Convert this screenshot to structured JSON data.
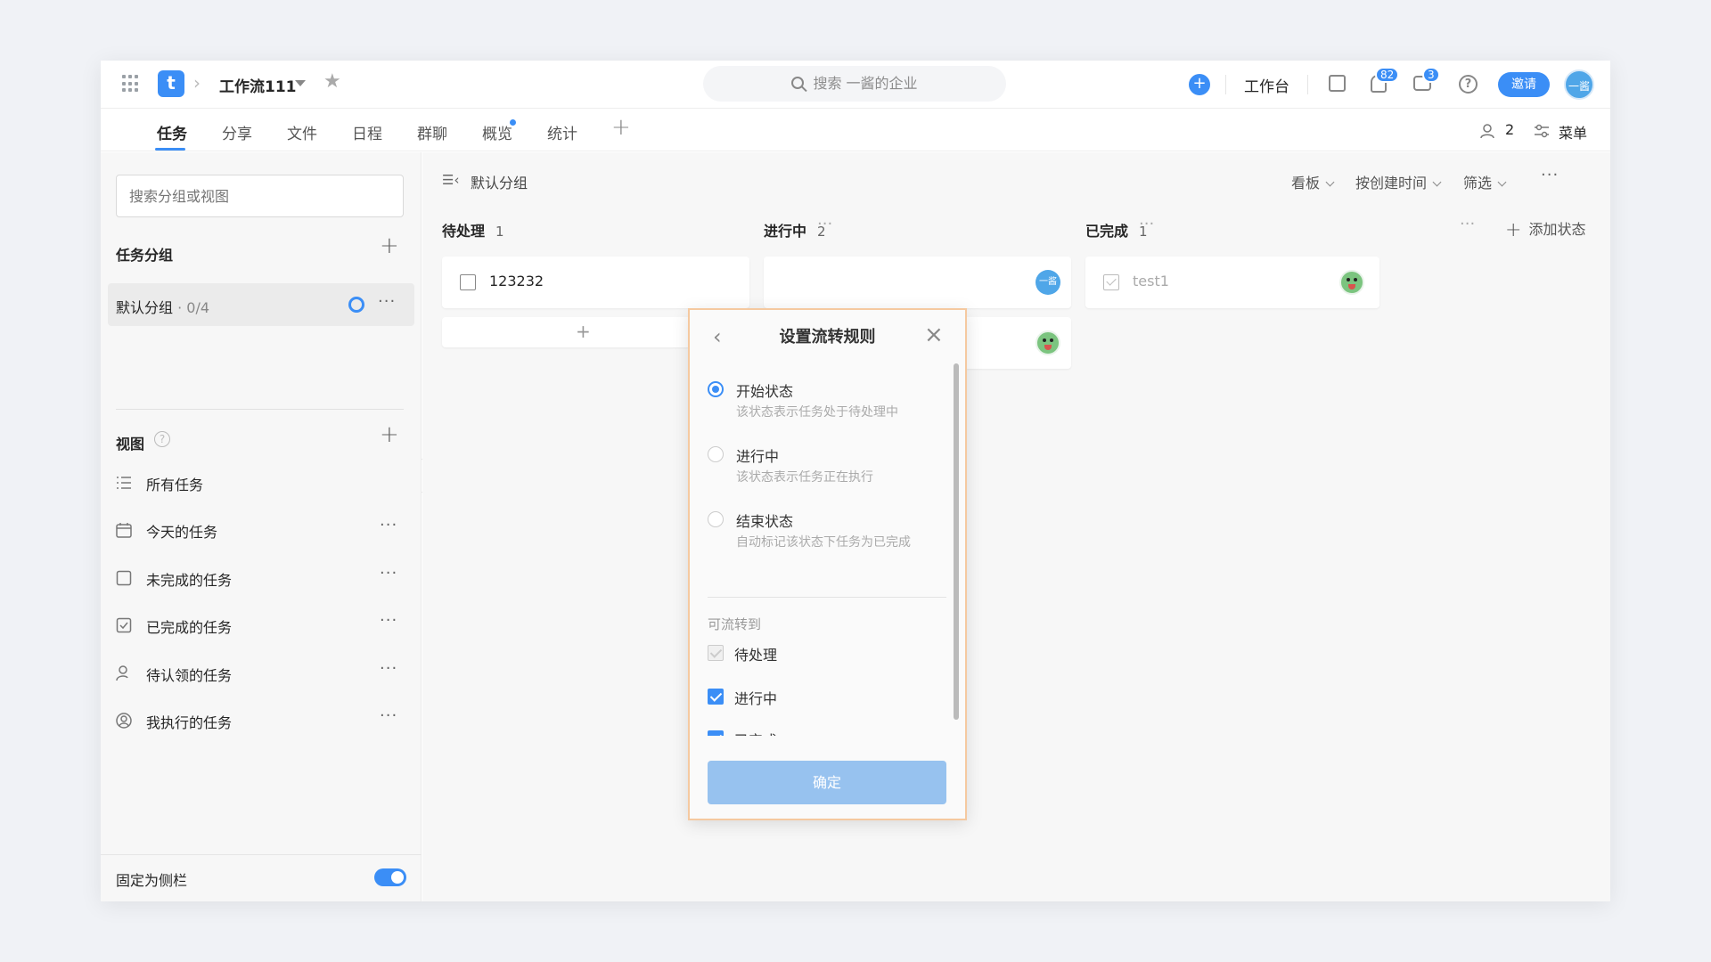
{
  "header": {
    "logo_letter": "t",
    "project_title": "工作流111",
    "search_placeholder": "搜索 一酱的企业",
    "workbench_label": "工作台",
    "notifications_count": "82",
    "messages_count": "3",
    "help_glyph": "?",
    "invite_label": "邀请",
    "avatar_text": "一酱"
  },
  "tabs": {
    "items": [
      "任务",
      "分享",
      "文件",
      "日程",
      "群聊",
      "概览",
      "统计"
    ],
    "active": "任务",
    "members_count": "2",
    "menu_label": "菜单"
  },
  "sidebar": {
    "search_placeholder": "搜索分组或视图",
    "groups_title": "任务分组",
    "default_group_label": "默认分组",
    "default_group_count": "· 0/4",
    "views_title": "视图",
    "views": [
      "所有任务",
      "今天的任务",
      "未完成的任务",
      "已完成的任务",
      "待认领的任务",
      "我执行的任务"
    ],
    "pin_label": "固定为侧栏"
  },
  "main": {
    "group_title": "默认分组",
    "view_mode": "看板",
    "sort_label": "按创建时间",
    "filter_label": "筛选",
    "columns": [
      {
        "name": "待处理",
        "count": "1",
        "cards": [
          "123232"
        ]
      },
      {
        "name": "进行中",
        "count": "2"
      },
      {
        "name": "已完成",
        "count": "1",
        "cards": [
          "test1"
        ]
      }
    ],
    "add_status_label": "添加状态"
  },
  "dialog": {
    "title": "设置流转规则",
    "options": [
      {
        "title": "开始状态",
        "desc": "该状态表示任务处于待处理中",
        "selected": true
      },
      {
        "title": "进行中",
        "desc": "该状态表示任务正在执行",
        "selected": false
      },
      {
        "title": "结束状态",
        "desc": "自动标记该状态下任务为已完成",
        "selected": false
      }
    ],
    "transition_title": "可流转到",
    "transitions": [
      {
        "label": "待处理",
        "checked": true,
        "disabled": true
      },
      {
        "label": "进行中",
        "checked": true
      },
      {
        "label": "已完成",
        "checked": true
      }
    ],
    "confirm_label": "确定"
  },
  "colors": {
    "accent": "#3b8ef6",
    "confirm_button": "#97c2ef",
    "dialog_border": "#f5c9a0"
  }
}
